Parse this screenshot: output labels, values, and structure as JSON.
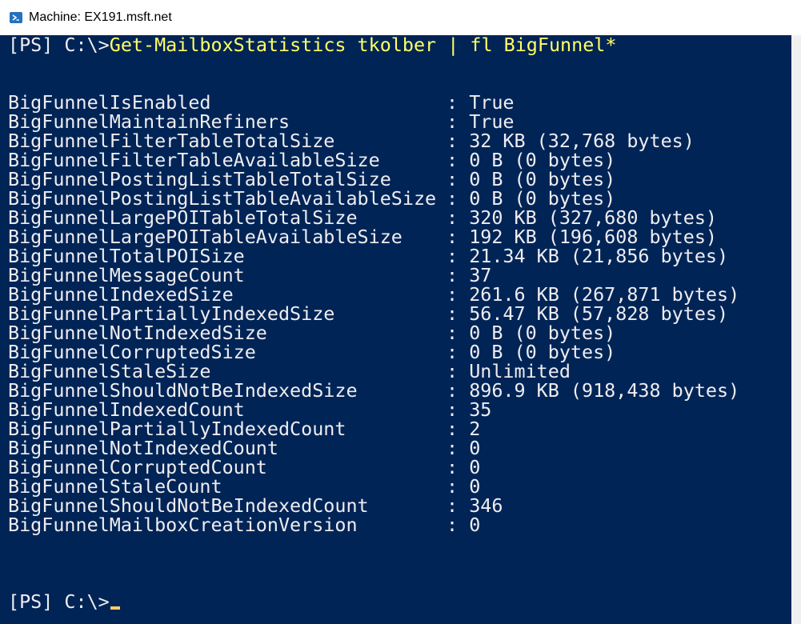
{
  "window": {
    "title": "Machine: EX191.msft.net",
    "icon": "powershell-icon"
  },
  "colors": {
    "console_bg": "#012456",
    "text": "#eeedf0",
    "command": "#ffff66",
    "cursor": "#fdcb6e"
  },
  "console": {
    "command_prompt": "[PS] C:\\>",
    "command_text": "Get-MailboxStatistics tkolber | fl BigFunnel*",
    "separator": ":",
    "properties": [
      {
        "name": "BigFunnelIsEnabled",
        "value": "True"
      },
      {
        "name": "BigFunnelMaintainRefiners",
        "value": "True"
      },
      {
        "name": "BigFunnelFilterTableTotalSize",
        "value": "32 KB (32,768 bytes)"
      },
      {
        "name": "BigFunnelFilterTableAvailableSize",
        "value": "0 B (0 bytes)"
      },
      {
        "name": "BigFunnelPostingListTableTotalSize",
        "value": "0 B (0 bytes)"
      },
      {
        "name": "BigFunnelPostingListTableAvailableSize",
        "value": "0 B (0 bytes)"
      },
      {
        "name": "BigFunnelLargePOITableTotalSize",
        "value": "320 KB (327,680 bytes)"
      },
      {
        "name": "BigFunnelLargePOITableAvailableSize",
        "value": "192 KB (196,608 bytes)"
      },
      {
        "name": "BigFunnelTotalPOISize",
        "value": "21.34 KB (21,856 bytes)"
      },
      {
        "name": "BigFunnelMessageCount",
        "value": "37"
      },
      {
        "name": "BigFunnelIndexedSize",
        "value": "261.6 KB (267,871 bytes)"
      },
      {
        "name": "BigFunnelPartiallyIndexedSize",
        "value": "56.47 KB (57,828 bytes)"
      },
      {
        "name": "BigFunnelNotIndexedSize",
        "value": "0 B (0 bytes)"
      },
      {
        "name": "BigFunnelCorruptedSize",
        "value": "0 B (0 bytes)"
      },
      {
        "name": "BigFunnelStaleSize",
        "value": "Unlimited"
      },
      {
        "name": "BigFunnelShouldNotBeIndexedSize",
        "value": "896.9 KB (918,438 bytes)"
      },
      {
        "name": "BigFunnelIndexedCount",
        "value": "35"
      },
      {
        "name": "BigFunnelPartiallyIndexedCount",
        "value": "2"
      },
      {
        "name": "BigFunnelNotIndexedCount",
        "value": "0"
      },
      {
        "name": "BigFunnelCorruptedCount",
        "value": "0"
      },
      {
        "name": "BigFunnelStaleCount",
        "value": "0"
      },
      {
        "name": "BigFunnelShouldNotBeIndexedCount",
        "value": "346"
      },
      {
        "name": "BigFunnelMailboxCreationVersion",
        "value": "0"
      }
    ],
    "final_prompt": "[PS] C:\\>"
  }
}
